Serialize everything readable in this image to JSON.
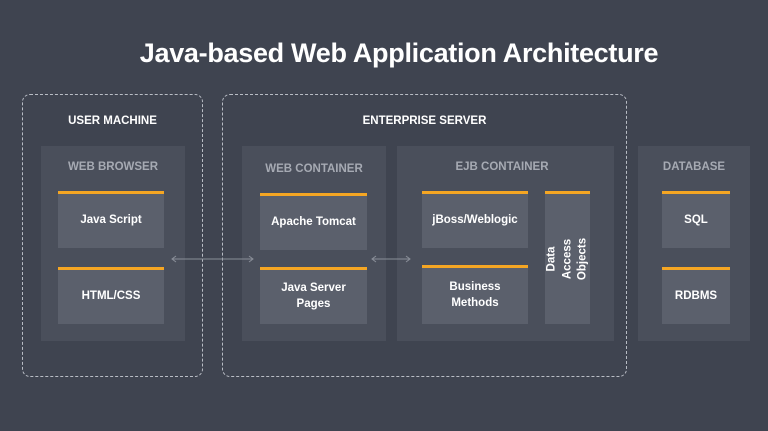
{
  "title": "Java-based Web Application Architecture",
  "regions": {
    "user_machine": "USER MACHINE",
    "enterprise_server": "ENTERPRISE SERVER"
  },
  "panels": {
    "web_browser": {
      "label": "WEB BROWSER",
      "items": [
        "Java Script",
        "HTML/CSS"
      ]
    },
    "web_container": {
      "label": "WEB CONTAINER",
      "items": [
        "Apache Tomcat",
        "Java Server\nPages"
      ]
    },
    "ejb_container": {
      "label": "EJB CONTAINER",
      "items": [
        "jBoss/Weblogic",
        "Business\nMethods"
      ],
      "side_item": "Data Access\nObjects"
    },
    "database": {
      "label": "DATABASE",
      "items": [
        "SQL",
        "RDBMS"
      ]
    }
  },
  "colors": {
    "background": "#3f4450",
    "panel": "#4a4f5b",
    "box": "#5b606c",
    "accent": "#f5a623"
  }
}
